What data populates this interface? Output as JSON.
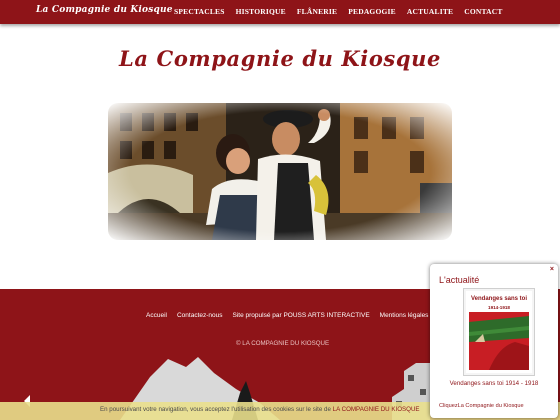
{
  "header": {
    "brand": "La Compagnie du Kiosque",
    "nav": [
      "SPECTACLES",
      "HISTORIQUE",
      "FLÂNERIE",
      "PEDAGOGIE",
      "ACTUALITE",
      "CONTACT"
    ]
  },
  "hero": {
    "title": "La Compagnie du Kiosque"
  },
  "footer": {
    "links": [
      "Accueil",
      "Contactez-nous",
      "Site propulsé par POUSS ARTS INTERACTIVE",
      "Mentions légales"
    ],
    "copyright": "© LA COMPAGNIE DU KIOSQUE"
  },
  "cookie": {
    "text": "En poursuivant votre navigation, vous acceptez l'utilisation des cookies sur le site de",
    "link": "LA COMPAGNIE DU KIOSQUE"
  },
  "news_popup": {
    "close": "×",
    "title": "L'actualité",
    "cover_title": "Vendanges sans toi",
    "cover_years": "1914-1918",
    "caption": "Vendanges sans toi 1914 - 1918",
    "credit_prefix": "Cliquez",
    "credit_link": "La Compagnie du Kiosque"
  },
  "colors": {
    "brand": "#8e1418",
    "cookie_bar": "#e9df8c",
    "text": "#4a4a4a"
  }
}
